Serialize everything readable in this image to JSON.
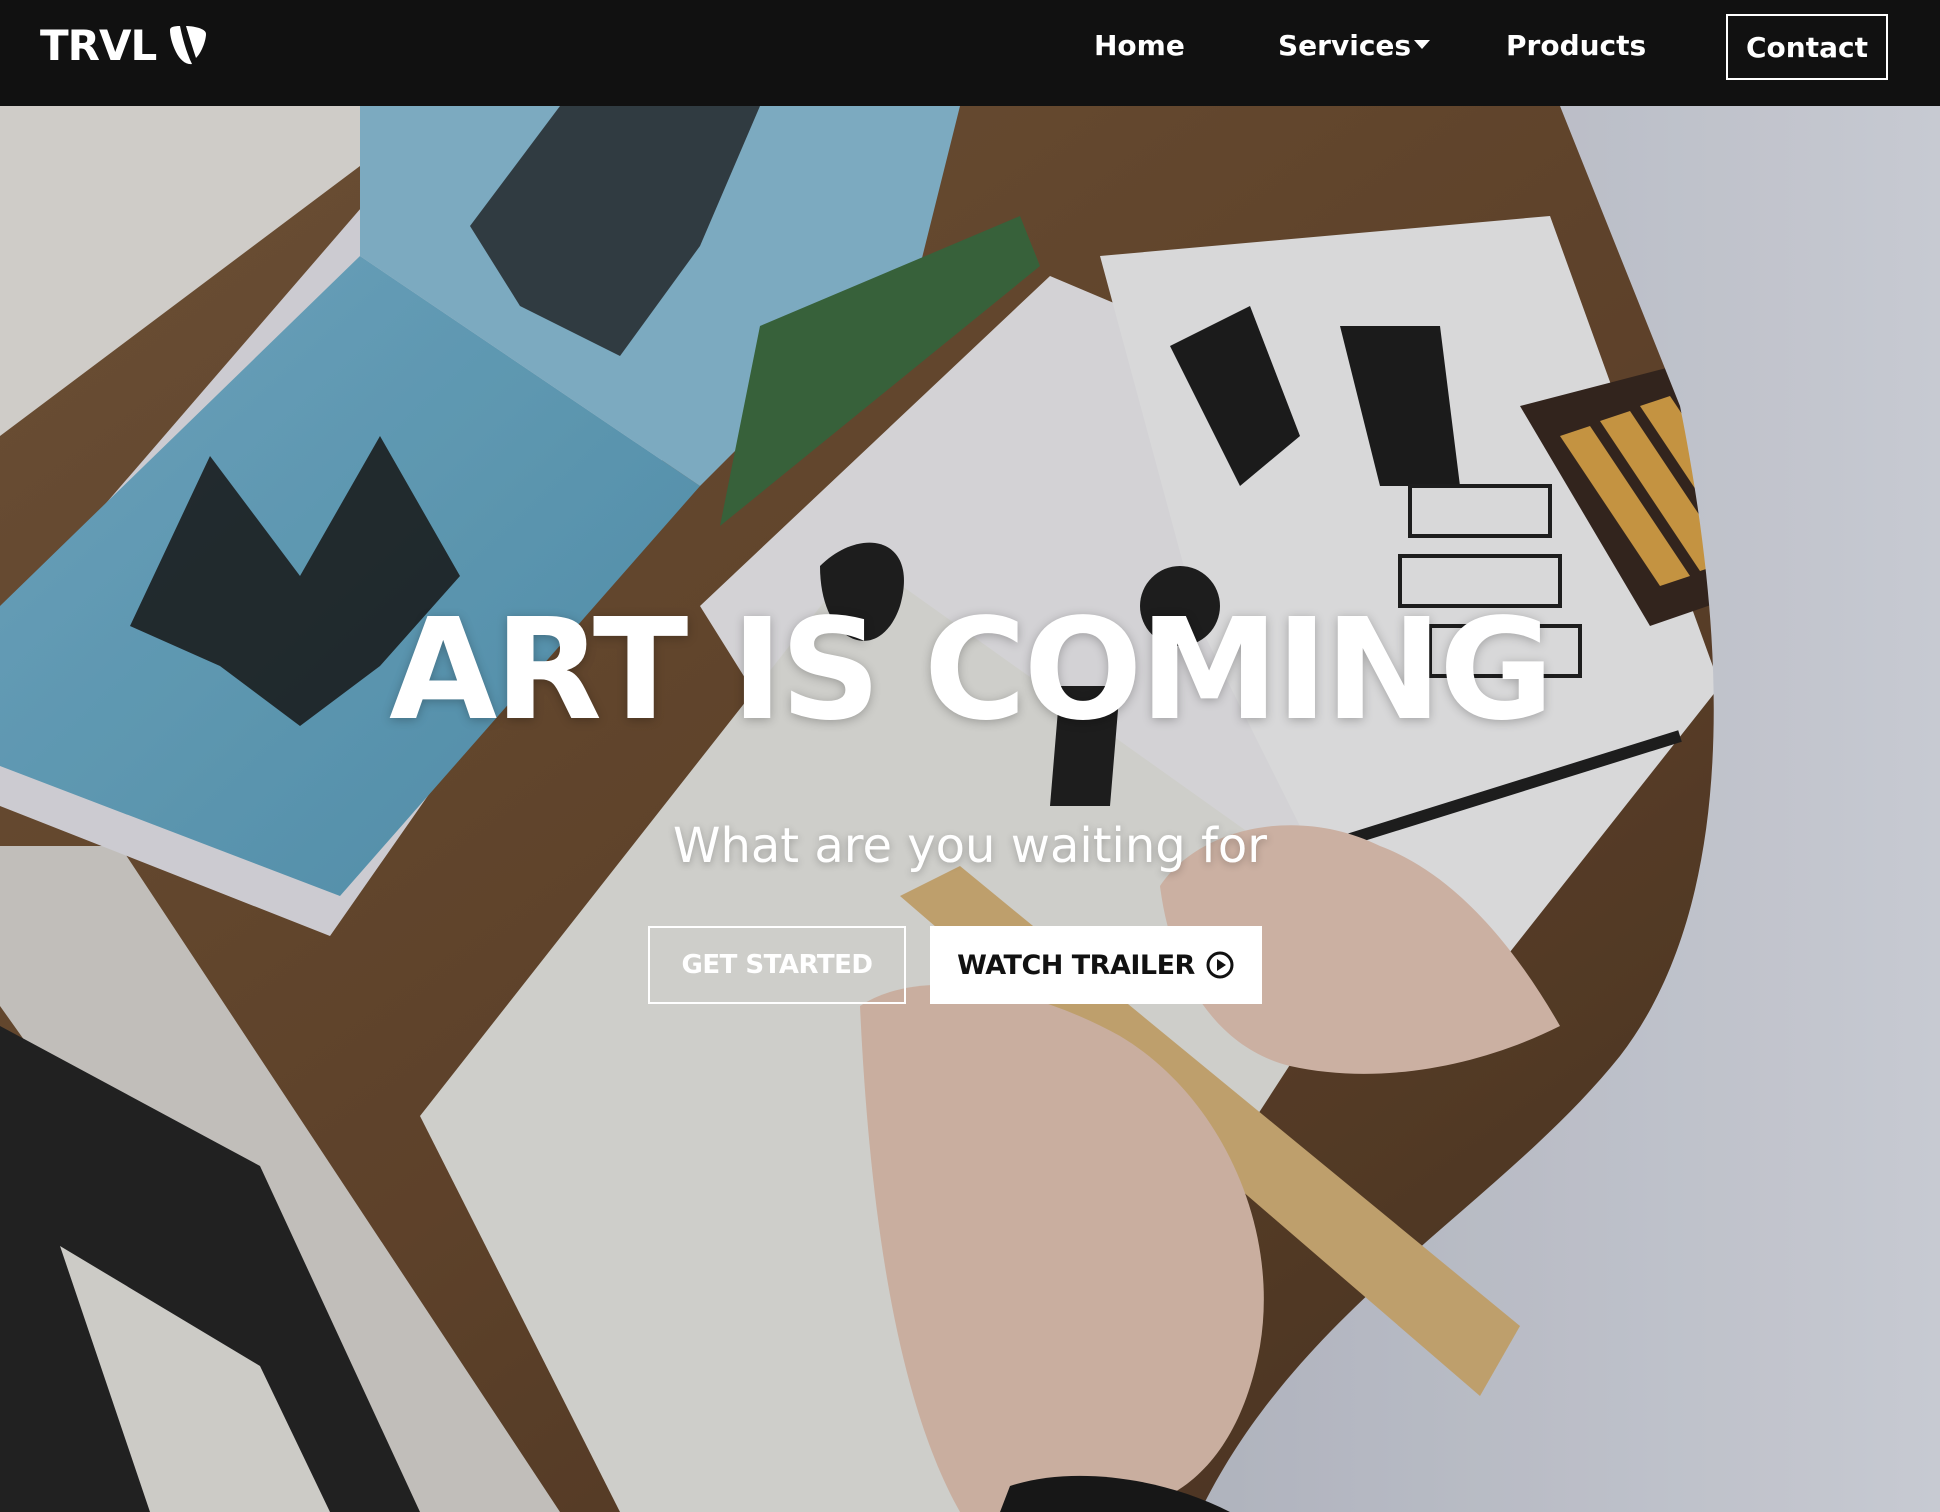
{
  "brand": {
    "name": "TRVL",
    "icon": "typo3-logo-icon"
  },
  "nav": {
    "home": "Home",
    "services": "Services",
    "products": "Products",
    "contact": "Contact"
  },
  "hero": {
    "background": "photo-artist-drawing-lettering-icon",
    "title": "ART IS COMING",
    "subtitle": "What are you waiting for",
    "primary_button": "GET STARTED",
    "secondary_button": "WATCH TRAILER",
    "secondary_button_icon": "play-circle-icon"
  },
  "colors": {
    "navbar_bg": "#111111",
    "text_light": "#ffffff",
    "text_dark": "#111111"
  }
}
